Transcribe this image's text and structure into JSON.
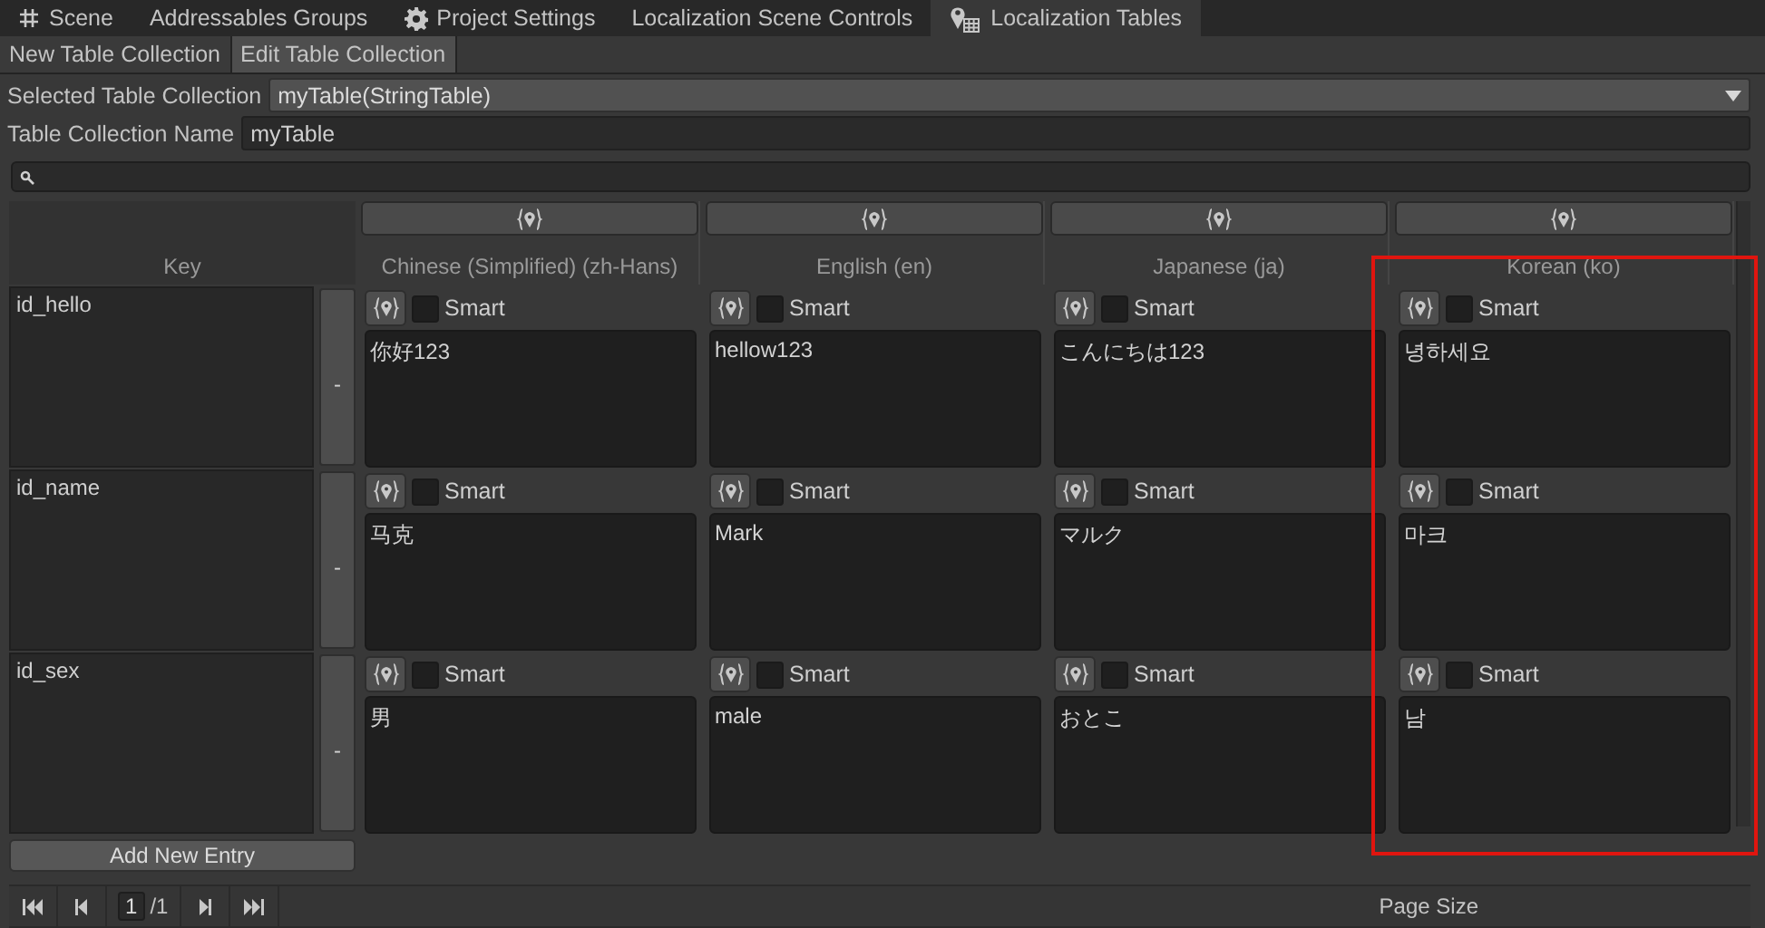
{
  "tabs": [
    {
      "label": "Scene",
      "kind": "hash",
      "selected": false
    },
    {
      "label": "Addressables Groups",
      "kind": "plain",
      "selected": false
    },
    {
      "label": "Project Settings",
      "kind": "gear",
      "selected": false
    },
    {
      "label": "Localization Scene Controls",
      "kind": "plain",
      "selected": false
    },
    {
      "label": "Localization Tables",
      "kind": "pin",
      "selected": true
    }
  ],
  "mode_tabs": [
    {
      "label": "New Table Collection",
      "selected": false
    },
    {
      "label": "Edit Table Collection",
      "selected": true
    }
  ],
  "selected_table_collection": {
    "label": "Selected Table Collection",
    "value": "myTable(StringTable)"
  },
  "table_collection_name": {
    "label": "Table Collection Name",
    "value": "myTable"
  },
  "table": {
    "key_header": "Key",
    "columns": [
      {
        "label": "Chinese (Simplified) (zh-Hans)",
        "highlighted": false
      },
      {
        "label": "English (en)",
        "highlighted": false
      },
      {
        "label": "Japanese (ja)",
        "highlighted": false
      },
      {
        "label": "Korean (ko)",
        "highlighted": true
      }
    ],
    "rows": [
      {
        "key": "id_hello",
        "remove": "-",
        "entries": [
          {
            "smart_label": "Smart",
            "smart": false,
            "value": "你好123"
          },
          {
            "smart_label": "Smart",
            "smart": false,
            "value": "hellow123"
          },
          {
            "smart_label": "Smart",
            "smart": false,
            "value": "こんにちは123"
          },
          {
            "smart_label": "Smart",
            "smart": false,
            "value": "녕하세요"
          }
        ]
      },
      {
        "key": "id_name",
        "remove": "-",
        "entries": [
          {
            "smart_label": "Smart",
            "smart": false,
            "value": "马克"
          },
          {
            "smart_label": "Smart",
            "smart": false,
            "value": "Mark"
          },
          {
            "smart_label": "Smart",
            "smart": false,
            "value": "マルク"
          },
          {
            "smart_label": "Smart",
            "smart": false,
            "value": "마크"
          }
        ]
      },
      {
        "key": "id_sex",
        "remove": "-",
        "entries": [
          {
            "smart_label": "Smart",
            "smart": false,
            "value": "男"
          },
          {
            "smart_label": "Smart",
            "smart": false,
            "value": "male"
          },
          {
            "smart_label": "Smart",
            "smart": false,
            "value": "おとこ"
          },
          {
            "smart_label": "Smart",
            "smart": false,
            "value": "남"
          }
        ]
      }
    ],
    "add_button": "Add New Entry"
  },
  "pager": {
    "page": "1",
    "total": "/1",
    "page_size_label": "Page Size"
  }
}
